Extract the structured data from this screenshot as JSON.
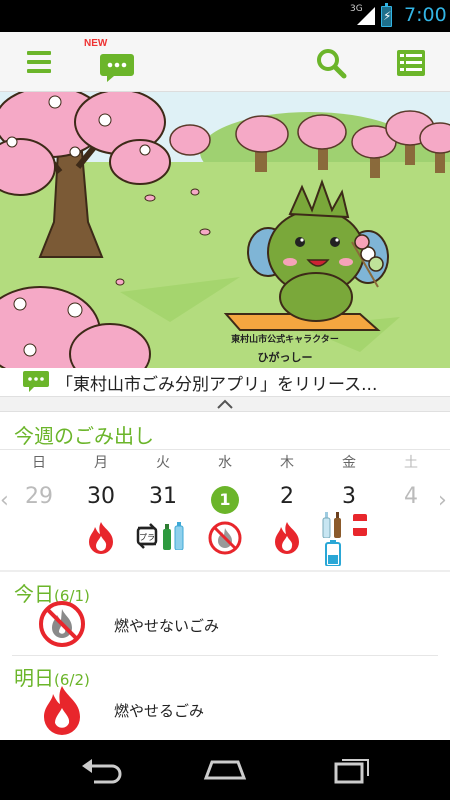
{
  "status_bar": {
    "network": "3G",
    "time": "7:00"
  },
  "action_bar": {
    "new_badge": "NEW"
  },
  "banner": {
    "caption_line1": "東村山市公式キャラクター",
    "caption_line2": "ひがっしー"
  },
  "news": {
    "text": "「東村山市ごみ分別アプリ」をリリース..."
  },
  "week": {
    "title": "今週のごみ出し",
    "days": [
      {
        "weekday": "日",
        "date": "29"
      },
      {
        "weekday": "月",
        "date": "30"
      },
      {
        "weekday": "火",
        "date": "31"
      },
      {
        "weekday": "水",
        "date": "1"
      },
      {
        "weekday": "木",
        "date": "2"
      },
      {
        "weekday": "金",
        "date": "3"
      },
      {
        "weekday": "土",
        "date": "4"
      }
    ],
    "prev_arrow": "‹",
    "next_arrow": "›"
  },
  "schedule": {
    "today": {
      "label": "今日",
      "date": "(6/1)",
      "item": "燃やせないごみ",
      "icon": "non-burnable-icon"
    },
    "tomorrow": {
      "label": "明日",
      "date": "(6/2)",
      "item": "燃やせるごみ",
      "icon": "burnable-flame-icon"
    }
  },
  "colors": {
    "brand_green": "#6bb52a",
    "flame_red": "#e8262c",
    "blossom_pink": "#f5a9c6",
    "status_blue": "#33b5e5"
  }
}
